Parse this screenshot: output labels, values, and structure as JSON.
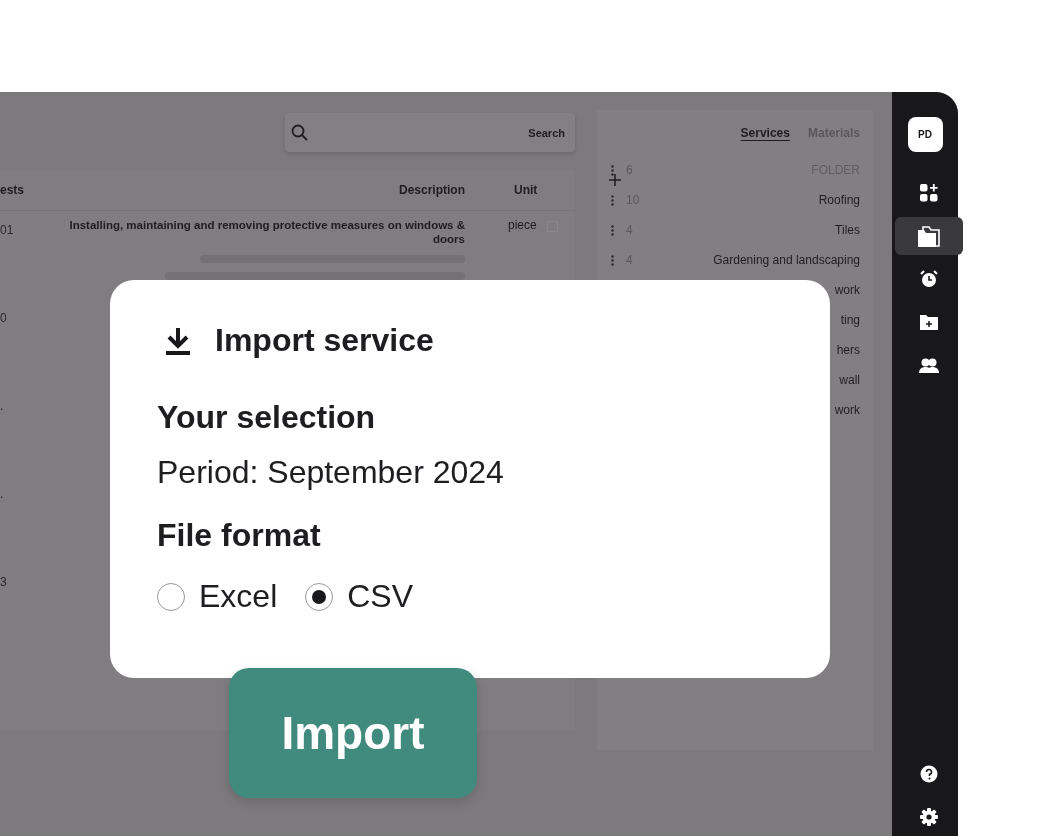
{
  "search": {
    "label": "Search"
  },
  "table": {
    "columns": [
      "ests",
      "Description",
      "Unit"
    ],
    "rows": [
      {
        "column_1": "01",
        "description": "Installing, maintaining and removing protective measures on windows & doors",
        "unit": "piece",
        "checked": false
      },
      {
        "column_1": "0"
      },
      {
        "column_1": "."
      },
      {
        "column_1": "."
      },
      {
        "column_1": "3"
      }
    ]
  },
  "catalog": {
    "tabs": [
      {
        "label": "Services",
        "selected": true
      },
      {
        "label": "Materials",
        "selected": false
      }
    ],
    "items": [
      {
        "kind": "new",
        "count": "6",
        "placeholder": "FOLDER"
      },
      {
        "kind": "folder",
        "count": "10",
        "name": "Roofing"
      },
      {
        "kind": "folder",
        "count": "4",
        "name": "Tiles"
      },
      {
        "kind": "folder",
        "count": "4",
        "name": "Gardening and landscaping"
      },
      {
        "kind": "partial",
        "name": "work"
      },
      {
        "kind": "partial",
        "name": "ting"
      },
      {
        "kind": "partial",
        "name": "hers"
      },
      {
        "kind": "partial",
        "name": "wall"
      },
      {
        "kind": "partial",
        "name": "work"
      }
    ]
  },
  "sidebar": {
    "avatar": "PD",
    "items": [
      {
        "kind": "grid-plus",
        "selected": false
      },
      {
        "kind": "folders",
        "selected": true
      },
      {
        "kind": "alarm",
        "selected": false
      },
      {
        "kind": "folder-plus",
        "selected": false
      },
      {
        "kind": "users",
        "selected": false
      }
    ],
    "bottom": [
      {
        "kind": "help",
        "selected": false
      },
      {
        "kind": "settings",
        "selected": false
      }
    ]
  },
  "dialog": {
    "title": "Import service",
    "selection_title": "Your selection",
    "selection": "Period: September 2024",
    "format_title": "File format",
    "options": [
      {
        "label": "Excel",
        "selected": false
      },
      {
        "label": "CSV",
        "selected": true
      }
    ],
    "button": "Import"
  }
}
